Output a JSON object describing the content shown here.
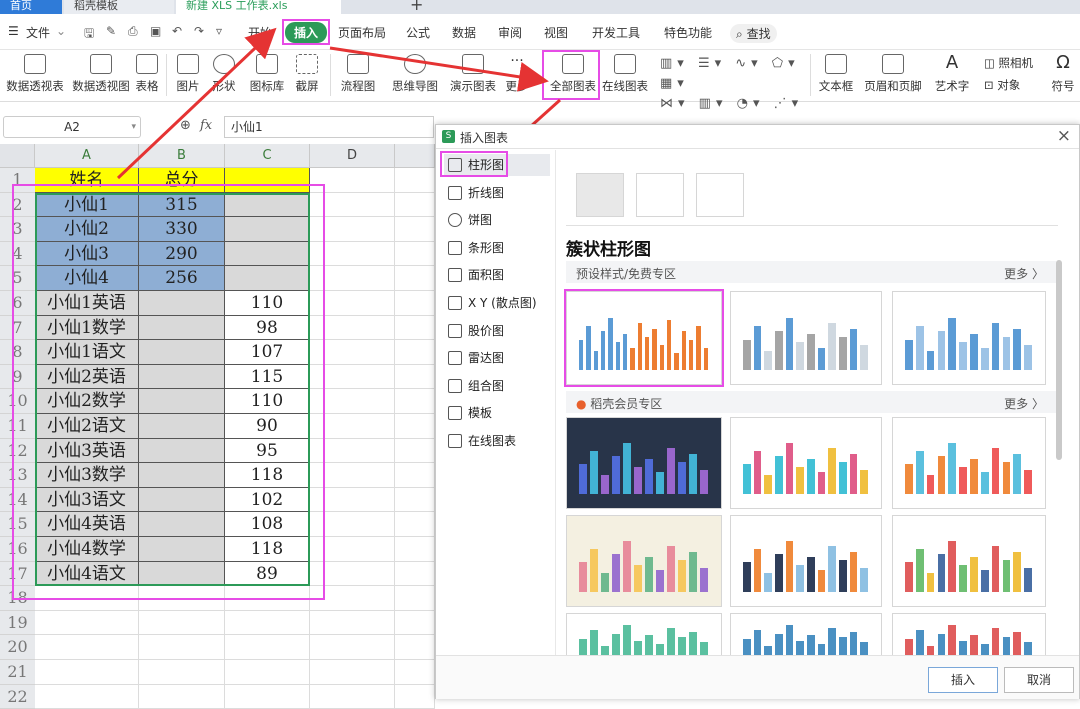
{
  "tabs": [
    {
      "label": "首页"
    },
    {
      "label": "稻壳模板"
    },
    {
      "label": "新建 XLS 工作表.xls"
    }
  ],
  "menubar": {
    "file": "文件",
    "items": [
      "开始",
      "插入",
      "页面布局",
      "公式",
      "数据",
      "审阅",
      "视图",
      "开发工具",
      "特色功能"
    ],
    "search": "查找"
  },
  "ribbon": {
    "buttons": [
      "数据透视表",
      "数据透视图",
      "表格",
      "图片",
      "形状",
      "图标库",
      "截屏",
      "流程图",
      "思维导图",
      "演示图表",
      "更多",
      "全部图表",
      "在线图表",
      "文本框",
      "页眉和页脚",
      "艺术字",
      "照相机",
      "对象",
      "符号"
    ]
  },
  "formula": {
    "cell_ref": "A2",
    "fx": "fx",
    "value": "小仙1"
  },
  "sheet": {
    "columns": [
      "A",
      "B",
      "C",
      "D"
    ],
    "row_numbers": [
      "1",
      "2",
      "3",
      "4",
      "5",
      "6",
      "7",
      "8",
      "9",
      "10",
      "11",
      "12",
      "13",
      "14",
      "15",
      "16",
      "17",
      "18",
      "19",
      "20",
      "21",
      "22"
    ],
    "header": {
      "a": "姓名",
      "b": "总分"
    },
    "summary_rows": [
      {
        "name": "小仙1",
        "total": "315"
      },
      {
        "name": "小仙2",
        "total": "330"
      },
      {
        "name": "小仙3",
        "total": "290"
      },
      {
        "name": "小仙4",
        "total": "256"
      }
    ],
    "detail_rows": [
      {
        "name": "小仙1英语",
        "score": "110"
      },
      {
        "name": "小仙1数学",
        "score": "98"
      },
      {
        "name": "小仙1语文",
        "score": "107"
      },
      {
        "name": "小仙2英语",
        "score": "115"
      },
      {
        "name": "小仙2数学",
        "score": "110"
      },
      {
        "name": "小仙2语文",
        "score": "90"
      },
      {
        "name": "小仙3英语",
        "score": "95"
      },
      {
        "name": "小仙3数学",
        "score": "118"
      },
      {
        "name": "小仙3语文",
        "score": "102"
      },
      {
        "name": "小仙4英语",
        "score": "108"
      },
      {
        "name": "小仙4数学",
        "score": "118"
      },
      {
        "name": "小仙4语文",
        "score": "89"
      }
    ]
  },
  "dialog": {
    "title": "插入图表",
    "close": "×",
    "nav": [
      "柱形图",
      "折线图",
      "饼图",
      "条形图",
      "面积图",
      "X Y (散点图)",
      "股价图",
      "雷达图",
      "组合图",
      "模板",
      "在线图表"
    ],
    "heading": "簇状柱形图",
    "section_free": "预设样式/免费专区",
    "section_member": "稻壳会员专区",
    "more": "更多 〉",
    "insert": "插入",
    "cancel": "取消"
  },
  "colors": {
    "accent_green": "#2c9a58",
    "highlight_magenta": "#e64ce6",
    "arrow_red": "#e53333",
    "header_yellow": "#ffff00",
    "selected_blue": "#8eaed4",
    "range_gray": "#d9d9d9"
  }
}
